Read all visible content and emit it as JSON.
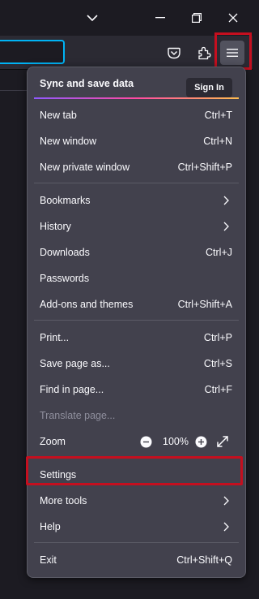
{
  "menu": {
    "sync_label": "Sync and save data",
    "signin_label": "Sign In",
    "items": [
      {
        "label": "New tab",
        "shortcut": "Ctrl+T"
      },
      {
        "label": "New window",
        "shortcut": "Ctrl+N"
      },
      {
        "label": "New private window",
        "shortcut": "Ctrl+Shift+P"
      },
      {
        "label": "Bookmarks"
      },
      {
        "label": "History"
      },
      {
        "label": "Downloads",
        "shortcut": "Ctrl+J"
      },
      {
        "label": "Passwords"
      },
      {
        "label": "Add-ons and themes",
        "shortcut": "Ctrl+Shift+A"
      },
      {
        "label": "Print...",
        "shortcut": "Ctrl+P"
      },
      {
        "label": "Save page as...",
        "shortcut": "Ctrl+S"
      },
      {
        "label": "Find in page...",
        "shortcut": "Ctrl+F"
      },
      {
        "label": "Translate page..."
      },
      {
        "label": "Zoom",
        "value": "100%"
      },
      {
        "label": "Settings"
      },
      {
        "label": "More tools"
      },
      {
        "label": "Help"
      },
      {
        "label": "Exit",
        "shortcut": "Ctrl+Shift+Q"
      }
    ]
  },
  "icons": {
    "tabs_list": "chevron-down-icon",
    "minimize": "minimize-icon",
    "restore": "restore-icon",
    "close": "close-icon",
    "pocket": "pocket-icon",
    "extensions": "puzzle-icon",
    "app_menu": "hamburger-menu-icon"
  },
  "colors": {
    "highlight": "#c50f1f",
    "focus": "#00b3f4",
    "panel": "#42414d"
  }
}
